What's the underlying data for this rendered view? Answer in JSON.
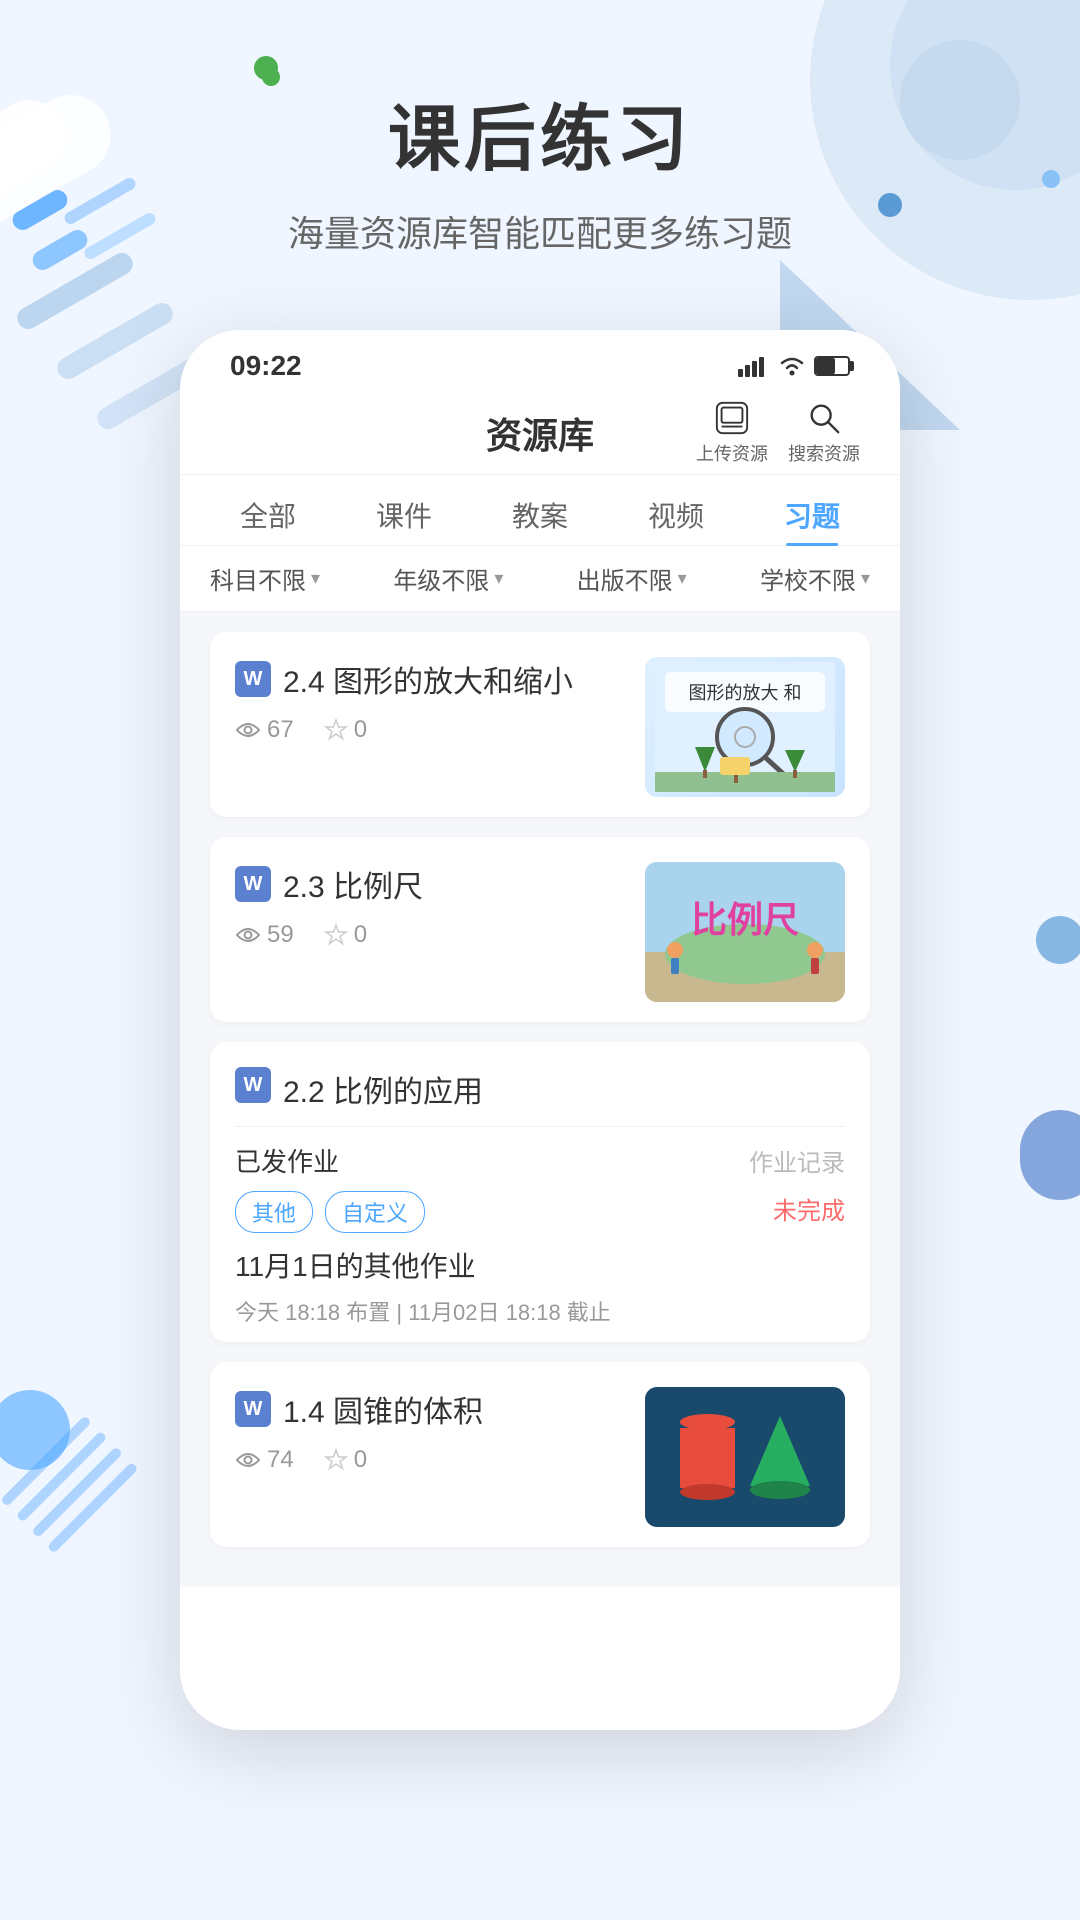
{
  "page": {
    "background_color": "#e8f2ff"
  },
  "header": {
    "title": "课后练习",
    "subtitle": "海量资源库智能匹配更多练习题"
  },
  "status_bar": {
    "time": "09:22",
    "icons": [
      "signal",
      "wifi",
      "battery"
    ]
  },
  "app_bar": {
    "title": "资源库",
    "upload_label": "上传资源",
    "search_label": "搜索资源"
  },
  "tabs": [
    {
      "label": "全部",
      "active": false
    },
    {
      "label": "课件",
      "active": false
    },
    {
      "label": "教案",
      "active": false
    },
    {
      "label": "视频",
      "active": false
    },
    {
      "label": "习题",
      "active": true
    }
  ],
  "filters": [
    {
      "label": "科目不限"
    },
    {
      "label": "年级不限"
    },
    {
      "label": "出版不限"
    },
    {
      "label": "学校不限"
    }
  ],
  "resources": [
    {
      "id": 1,
      "icon": "W",
      "title": "2.4 图形的放大和缩小",
      "views": 67,
      "stars": 0,
      "thumb_type": "enlarge"
    },
    {
      "id": 2,
      "icon": "W",
      "title": "2.3 比例尺",
      "views": 59,
      "stars": 0,
      "thumb_type": "scale"
    },
    {
      "id": 3,
      "icon": "W",
      "title": "2.2 比例的应用",
      "views": null,
      "stars": null,
      "thumb_type": null,
      "has_homework": true,
      "homework": {
        "section_title": "已发作业",
        "record_label": "作业记录",
        "tags": [
          "其他",
          "自定义"
        ],
        "status": "未完成",
        "name": "11月1日的其他作业",
        "time": "今天 18:18 布置 | 11月02日 18:18 截止"
      }
    },
    {
      "id": 4,
      "icon": "W",
      "title": "1.4 圆锥的体积",
      "views": 74,
      "stars": 0,
      "thumb_type": "cone"
    }
  ]
}
